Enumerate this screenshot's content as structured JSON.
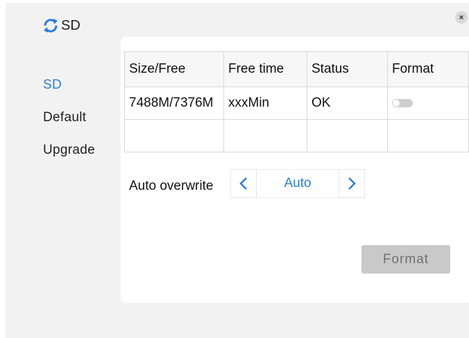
{
  "app": {
    "title": "SD",
    "logo_icon": "refresh-circle-icon"
  },
  "close": {
    "label": "×"
  },
  "sidebar": {
    "items": [
      {
        "label": "SD",
        "active": true
      },
      {
        "label": "Default",
        "active": false
      },
      {
        "label": "Upgrade",
        "active": false
      }
    ]
  },
  "table": {
    "headers": [
      "Size/Free",
      "Free time",
      "Status",
      "Format"
    ],
    "rows": [
      [
        "7488M/7376M",
        "xxxMin",
        "OK",
        ""
      ],
      [
        "",
        "",
        "",
        ""
      ]
    ],
    "format_toggle_on": false
  },
  "auto_overwrite": {
    "label": "Auto overwrite",
    "value": "Auto"
  },
  "format_button": {
    "label": "Format",
    "enabled": false
  },
  "colors": {
    "accent": "#2a7de1",
    "disabled_button": "#c9c9c9"
  }
}
